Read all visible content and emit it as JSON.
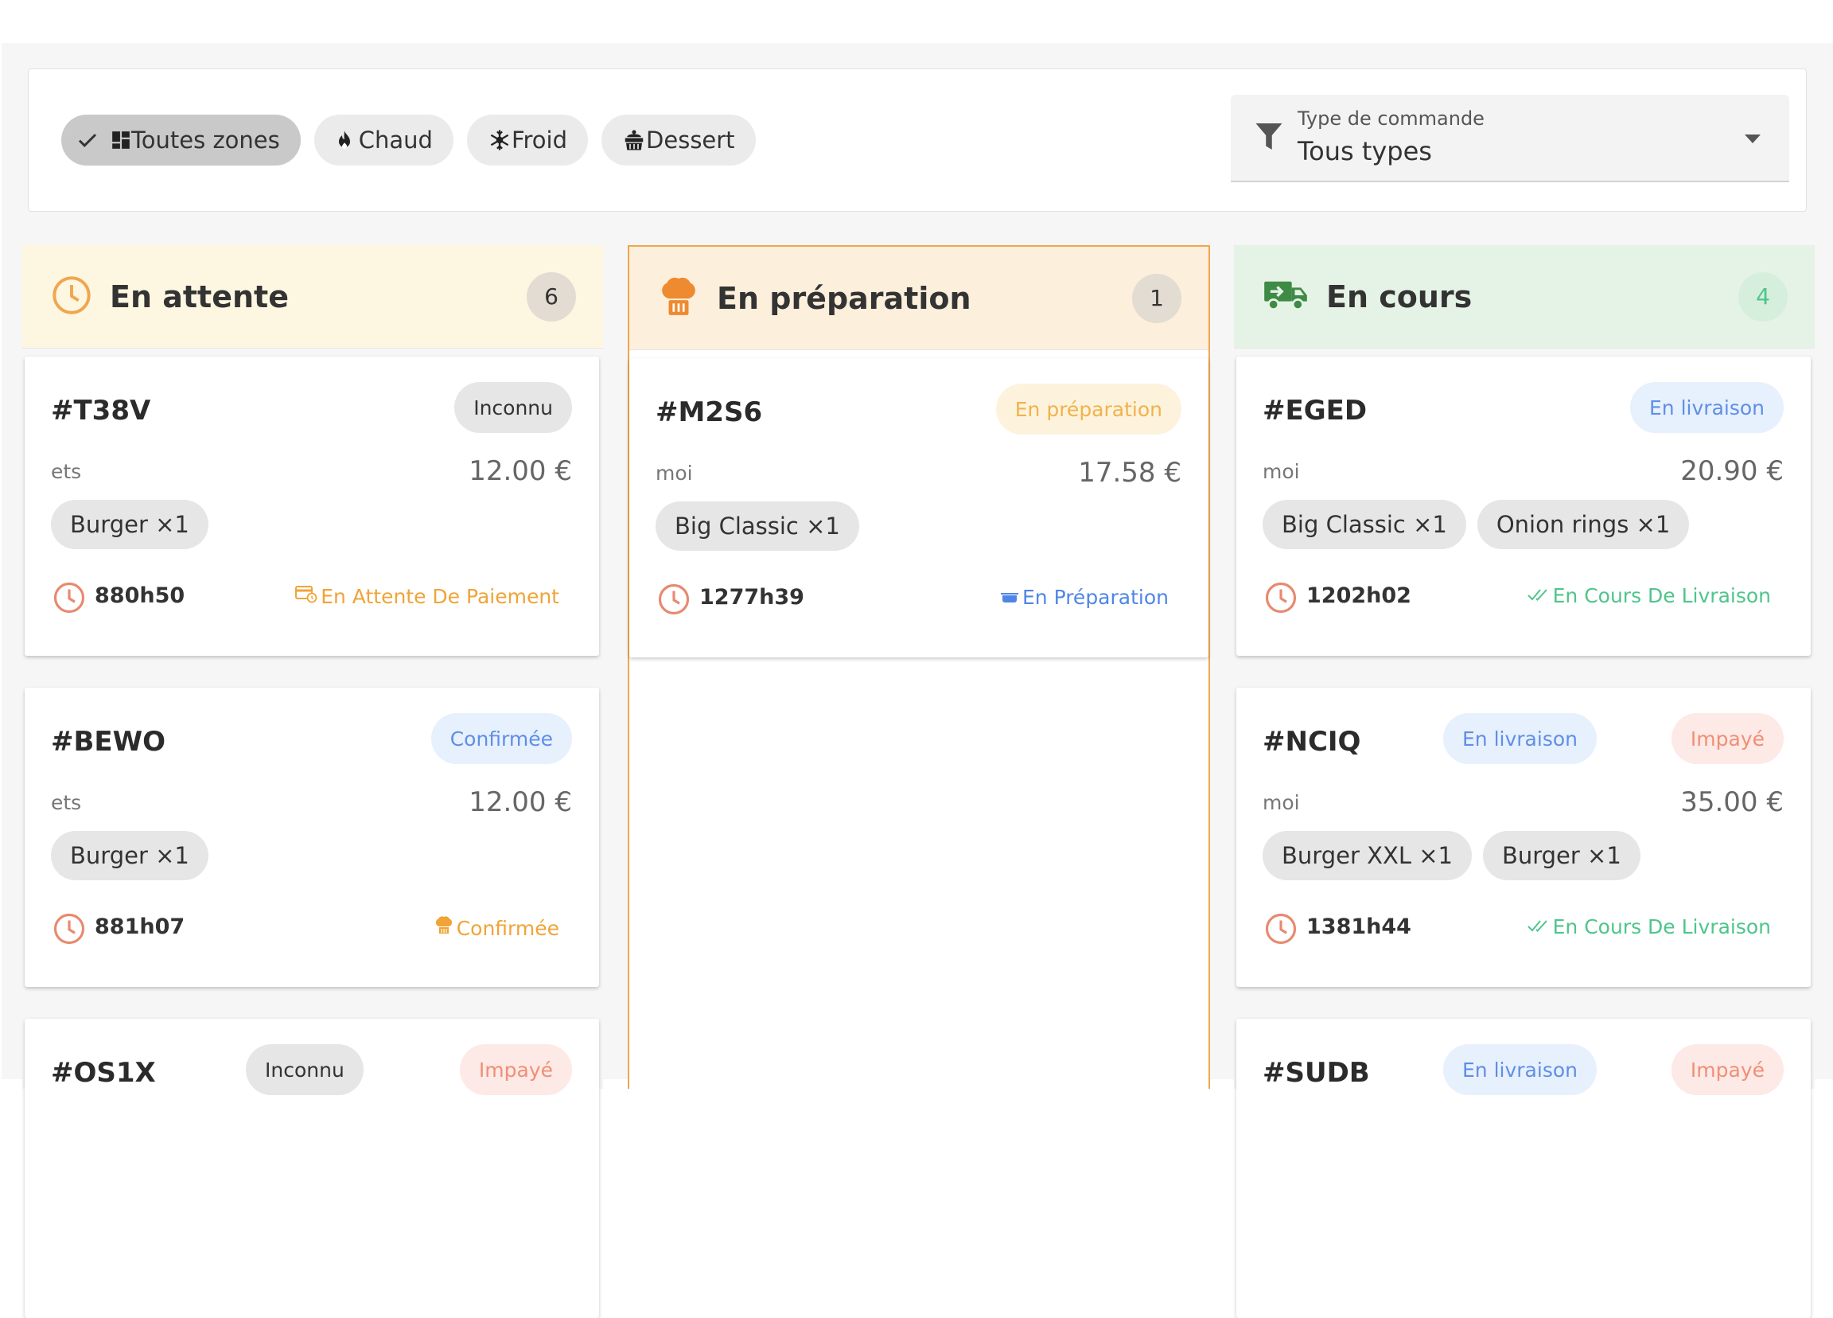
{
  "filters": {
    "chips": [
      {
        "label": "Toutes zones",
        "active": true,
        "icon": "dashboard-icon"
      },
      {
        "label": "Chaud",
        "active": false,
        "icon": "flame-icon"
      },
      {
        "label": "Froid",
        "active": false,
        "icon": "snowflake-icon"
      },
      {
        "label": "Dessert",
        "active": false,
        "icon": "cake-icon"
      }
    ],
    "order_type": {
      "label": "Type de commande",
      "value": "Tous types"
    }
  },
  "columns": [
    {
      "title": "En attente",
      "count": "6",
      "icon": "clock-icon",
      "cards": [
        {
          "code": "#T38V",
          "badges": [
            {
              "text": "Inconnu",
              "tone": "grey"
            }
          ],
          "client": "ets",
          "price": "12.00 €",
          "items": [
            "Burger ×1"
          ],
          "time": "880h50",
          "status": "En Attente De Paiement",
          "status_icon": "payment-icon",
          "status_tone": "orange"
        },
        {
          "code": "#BEWO",
          "badges": [
            {
              "text": "Confirmée",
              "tone": "blue"
            }
          ],
          "client": "ets",
          "price": "12.00 €",
          "items": [
            "Burger ×1"
          ],
          "time": "881h07",
          "status": "Confirmée",
          "status_icon": "chef-icon",
          "status_tone": "orange"
        },
        {
          "code": "#OS1X",
          "badges": [
            {
              "text": "Inconnu",
              "tone": "grey"
            },
            {
              "text": "Impayé",
              "tone": "red"
            }
          ],
          "client": "",
          "price": "",
          "items": [],
          "time": "",
          "status": "",
          "status_icon": "",
          "status_tone": "orange"
        }
      ]
    },
    {
      "title": "En préparation",
      "count": "1",
      "icon": "chef-hat-icon",
      "cards": [
        {
          "code": "#M2S6",
          "badges": [
            {
              "text": "En préparation",
              "tone": "yellow"
            }
          ],
          "client": "moi",
          "price": "17.58 €",
          "items": [
            "Big Classic ×1"
          ],
          "time": "1277h39",
          "status": "En Préparation",
          "status_icon": "pot-icon",
          "status_tone": "blue"
        }
      ]
    },
    {
      "title": "En cours",
      "count": "4",
      "icon": "truck-icon",
      "cards": [
        {
          "code": "#EGED",
          "badges": [
            {
              "text": "En livraison",
              "tone": "blue"
            }
          ],
          "client": "moi",
          "price": "20.90 €",
          "items": [
            "Big Classic ×1",
            "Onion rings ×1"
          ],
          "time": "1202h02",
          "status": "En Cours De Livraison",
          "status_icon": "double-check-icon",
          "status_tone": "green"
        },
        {
          "code": "#NCIQ",
          "badges": [
            {
              "text": "En livraison",
              "tone": "blue"
            },
            {
              "text": "Impayé",
              "tone": "red"
            }
          ],
          "client": "moi",
          "price": "35.00 €",
          "items": [
            "Burger XXL ×1",
            "Burger ×1"
          ],
          "time": "1381h44",
          "status": "En Cours De Livraison",
          "status_icon": "double-check-icon",
          "status_tone": "green"
        },
        {
          "code": "#SUDB",
          "badges": [
            {
              "text": "En livraison",
              "tone": "blue"
            },
            {
              "text": "Impayé",
              "tone": "red"
            }
          ],
          "client": "",
          "price": "",
          "items": [],
          "time": "",
          "status": "",
          "status_icon": "",
          "status_tone": "green"
        }
      ]
    }
  ],
  "colors": {
    "accent_orange": "#f0a64e",
    "green": "#4fc58b",
    "blue": "#5f8fe6",
    "red": "#ef8f77"
  }
}
